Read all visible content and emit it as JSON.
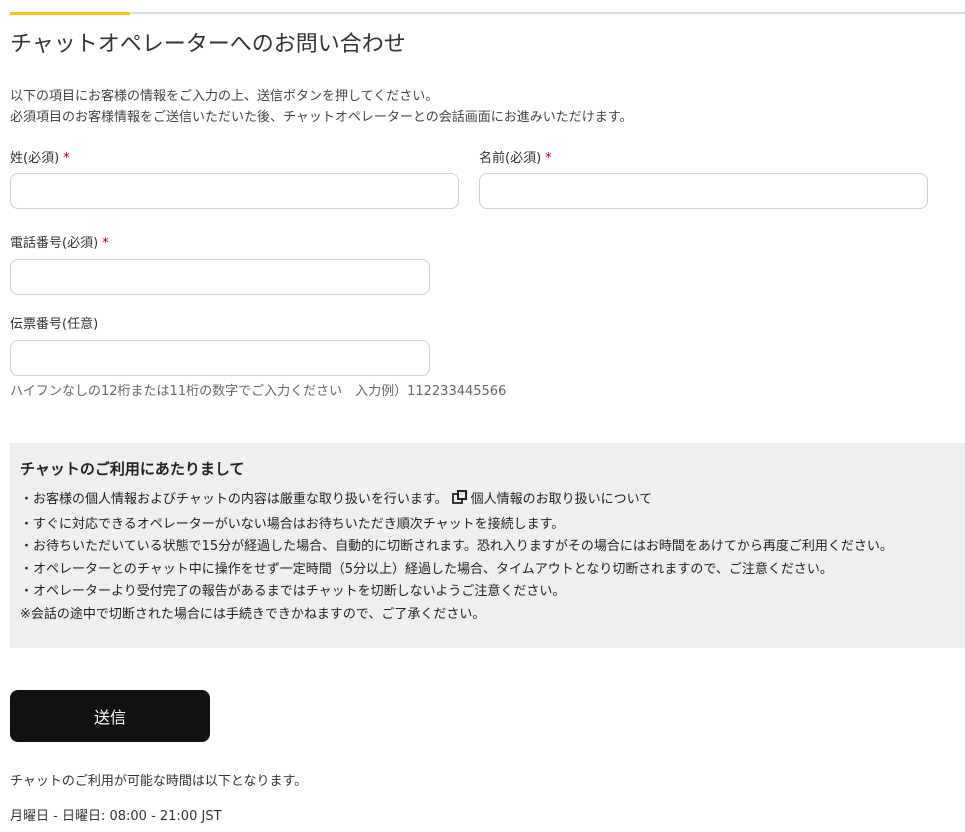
{
  "page": {
    "title": "チャットオペレーターへのお問い合わせ",
    "intro_line1": "以下の項目にお客様の情報をご入力の上、送信ボタンを押してください。",
    "intro_line2": "必須項目のお客様情報をご送信いただいた後、チャットオペレーターとの会話画面にお進みいただけます。",
    "accent_color": "#f5c518"
  },
  "form": {
    "last_name": {
      "label": "姓(必須)",
      "required_mark": "*",
      "value": ""
    },
    "first_name": {
      "label": "名前(必須)",
      "required_mark": "*",
      "value": ""
    },
    "phone": {
      "label": "電話番号(必須)",
      "required_mark": "*",
      "value": ""
    },
    "slip": {
      "label": "伝票番号(任意)",
      "value": "",
      "hint": "ハイフンなしの12桁または11桁の数字でご入力ください　入力例）112233445566"
    },
    "submit_label": "送信"
  },
  "notice": {
    "title": "チャットのご利用にあたりまして",
    "line1_prefix": "・お客様の個人情報およびチャットの内容は厳重な取り扱いを行います。",
    "privacy_link": "個人情報のお取り扱いについて",
    "line2": "・すぐに対応できるオペレーターがいない場合はお待ちいただき順次チャットを接続します。",
    "line3": "・お待ちいただいている状態で15分が経過した場合、自動的に切断されます。恐れ入りますがその場合にはお時間をあけてから再度ご利用ください。",
    "line4": "・オペレーターとのチャット中に操作をせず一定時間（5分以上）経過した場合、タイムアウトとなり切断されますので、ご注意ください。",
    "line5": "・オペレーターより受付完了の報告があるまではチャットを切断しないようご注意ください。",
    "line6": "※会話の途中で切断された場合には手続きできかねますので、ご了承ください。"
  },
  "hours": {
    "intro": "チャットのご利用が可能な時間は以下となります。",
    "schedule": "月曜日 - 日曜日:  08:00 - 21:00 JST"
  },
  "icons": {
    "privacy_link_icon": "copy-icon"
  }
}
